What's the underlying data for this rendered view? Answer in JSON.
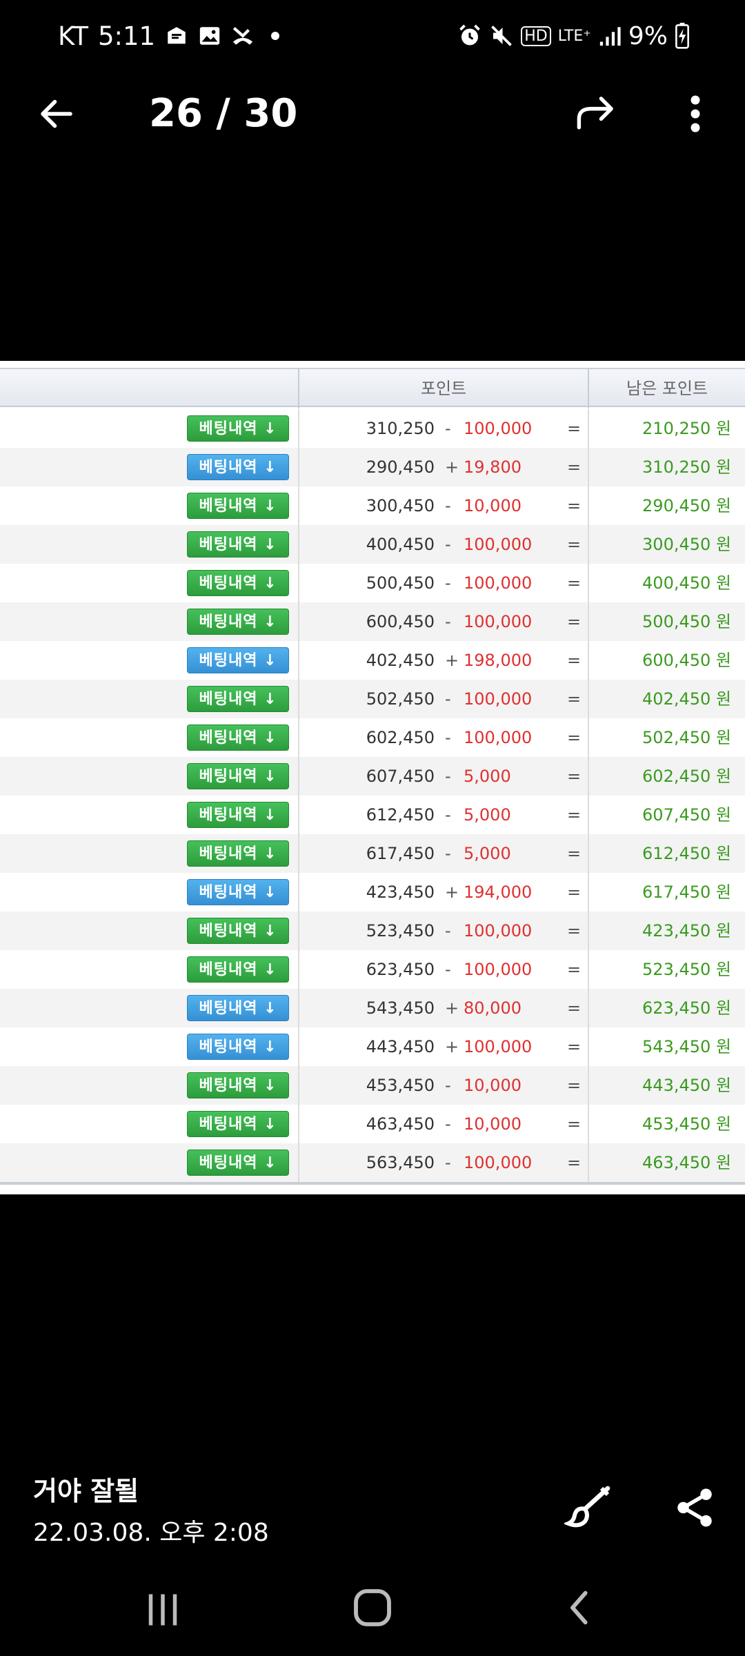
{
  "status_bar": {
    "carrier": "KT",
    "time": "5:11",
    "network": "HD",
    "lte": "LTE⁺",
    "battery": "9%"
  },
  "top_bar": {
    "counter": "26 / 30"
  },
  "table": {
    "headers": [
      "포인트",
      "남은 포인트"
    ],
    "button_label": "베팅내역 ↓",
    "rows": [
      {
        "btn": "green",
        "prev": "310,250",
        "op": "-",
        "amount": "100,000",
        "eq": "=",
        "remaining": "210,250 원"
      },
      {
        "btn": "blue",
        "prev": "290,450",
        "op": "+",
        "amount": "19,800",
        "eq": "=",
        "remaining": "310,250 원"
      },
      {
        "btn": "green",
        "prev": "300,450",
        "op": "-",
        "amount": "10,000",
        "eq": "=",
        "remaining": "290,450 원"
      },
      {
        "btn": "green",
        "prev": "400,450",
        "op": "-",
        "amount": "100,000",
        "eq": "=",
        "remaining": "300,450 원"
      },
      {
        "btn": "green",
        "prev": "500,450",
        "op": "-",
        "amount": "100,000",
        "eq": "=",
        "remaining": "400,450 원"
      },
      {
        "btn": "green",
        "prev": "600,450",
        "op": "-",
        "amount": "100,000",
        "eq": "=",
        "remaining": "500,450 원"
      },
      {
        "btn": "blue",
        "prev": "402,450",
        "op": "+",
        "amount": "198,000",
        "eq": "=",
        "remaining": "600,450 원"
      },
      {
        "btn": "green",
        "prev": "502,450",
        "op": "-",
        "amount": "100,000",
        "eq": "=",
        "remaining": "402,450 원"
      },
      {
        "btn": "green",
        "prev": "602,450",
        "op": "-",
        "amount": "100,000",
        "eq": "=",
        "remaining": "502,450 원"
      },
      {
        "btn": "green",
        "prev": "607,450",
        "op": "-",
        "amount": "5,000",
        "eq": "=",
        "remaining": "602,450 원"
      },
      {
        "btn": "green",
        "prev": "612,450",
        "op": "-",
        "amount": "5,000",
        "eq": "=",
        "remaining": "607,450 원"
      },
      {
        "btn": "green",
        "prev": "617,450",
        "op": "-",
        "amount": "5,000",
        "eq": "=",
        "remaining": "612,450 원"
      },
      {
        "btn": "blue",
        "prev": "423,450",
        "op": "+",
        "amount": "194,000",
        "eq": "=",
        "remaining": "617,450 원"
      },
      {
        "btn": "green",
        "prev": "523,450",
        "op": "-",
        "amount": "100,000",
        "eq": "=",
        "remaining": "423,450 원"
      },
      {
        "btn": "green",
        "prev": "623,450",
        "op": "-",
        "amount": "100,000",
        "eq": "=",
        "remaining": "523,450 원"
      },
      {
        "btn": "blue",
        "prev": "543,450",
        "op": "+",
        "amount": "80,000",
        "eq": "=",
        "remaining": "623,450 원"
      },
      {
        "btn": "blue",
        "prev": "443,450",
        "op": "+",
        "amount": "100,000",
        "eq": "=",
        "remaining": "543,450 원"
      },
      {
        "btn": "green",
        "prev": "453,450",
        "op": "-",
        "amount": "10,000",
        "eq": "=",
        "remaining": "443,450 원"
      },
      {
        "btn": "green",
        "prev": "463,450",
        "op": "-",
        "amount": "10,000",
        "eq": "=",
        "remaining": "453,450 원"
      },
      {
        "btn": "green",
        "prev": "563,450",
        "op": "-",
        "amount": "100,000",
        "eq": "=",
        "remaining": "463,450 원"
      }
    ]
  },
  "caption": {
    "title": "거야 잘될",
    "date": "22.03.08. 오후 2:08"
  },
  "colors": {
    "green_button": "#2d9c3c",
    "blue_button": "#3590d4",
    "amount_red": "#e03030",
    "remaining_green": "#3a9a1f"
  },
  "icons": {
    "top_bar": [
      "back-arrow-icon",
      "share-arrow-icon",
      "more-vert-icon"
    ],
    "caption": [
      "brush-icon",
      "share-icon"
    ],
    "nav": [
      "recent-apps-icon",
      "home-icon",
      "back-icon"
    ]
  }
}
